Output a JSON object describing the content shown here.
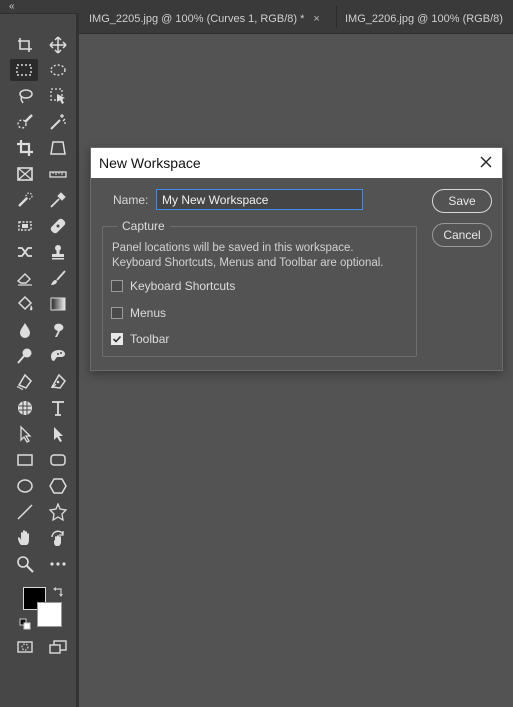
{
  "tabs": [
    {
      "label": "IMG_2205.jpg @ 100% (Curves 1, RGB/8) *",
      "close": "×"
    },
    {
      "label": "IMG_2206.jpg @ 100% (RGB/8)"
    }
  ],
  "toolbar": {
    "collapse_glyph": "«",
    "tools": [
      {
        "name": "artboard-icon"
      },
      {
        "name": "move-icon"
      },
      {
        "name": "rectangular-marquee-icon"
      },
      {
        "name": "elliptical-marquee-icon"
      },
      {
        "name": "lasso-icon"
      },
      {
        "name": "object-selection-icon"
      },
      {
        "name": "quick-selection-icon"
      },
      {
        "name": "magic-wand-icon"
      },
      {
        "name": "crop-icon"
      },
      {
        "name": "perspective-crop-icon"
      },
      {
        "name": "frame-icon"
      },
      {
        "name": "ruler-icon"
      },
      {
        "name": "spot-healing-icon"
      },
      {
        "name": "eyedropper-icon"
      },
      {
        "name": "pattern-stamp-icon"
      },
      {
        "name": "healing-bandage-icon"
      },
      {
        "name": "content-aware-move-icon"
      },
      {
        "name": "clone-stamp-icon"
      },
      {
        "name": "eraser-icon"
      },
      {
        "name": "brush-icon"
      },
      {
        "name": "paint-bucket-icon"
      },
      {
        "name": "gradient-icon"
      },
      {
        "name": "blur-icon"
      },
      {
        "name": "smudge-icon"
      },
      {
        "name": "dodge-icon"
      },
      {
        "name": "sponge-icon"
      },
      {
        "name": "freeform-pen-icon"
      },
      {
        "name": "pen-icon"
      },
      {
        "name": "color-sampler-3d-icon"
      },
      {
        "name": "type-icon"
      },
      {
        "name": "direct-selection-icon"
      },
      {
        "name": "path-selection-icon"
      },
      {
        "name": "rectangle-icon"
      },
      {
        "name": "rounded-rectangle-icon"
      },
      {
        "name": "ellipse-icon"
      },
      {
        "name": "polygon-icon"
      },
      {
        "name": "line-icon"
      },
      {
        "name": "custom-shape-icon"
      },
      {
        "name": "hand-icon"
      },
      {
        "name": "rotate-view-icon"
      },
      {
        "name": "zoom-icon"
      },
      {
        "name": "more-tools-icon"
      }
    ],
    "foreground_color": "#000000",
    "background_color": "#ffffff"
  },
  "dialog": {
    "title": "New Workspace",
    "name_label": "Name:",
    "name_value": "My New Workspace",
    "capture_legend": "Capture",
    "description_line1": "Panel locations will be saved in this workspace.",
    "description_line2": "Keyboard Shortcuts, Menus and Toolbar are optional.",
    "options": [
      {
        "label": "Keyboard Shortcuts",
        "checked": false
      },
      {
        "label": "Menus",
        "checked": false
      },
      {
        "label": "Toolbar",
        "checked": true
      }
    ],
    "save_label": "Save",
    "cancel_label": "Cancel"
  },
  "colors": {
    "app_bg": "#535353",
    "toolbar_bg": "#474747",
    "focus_border": "#3d8eea"
  }
}
